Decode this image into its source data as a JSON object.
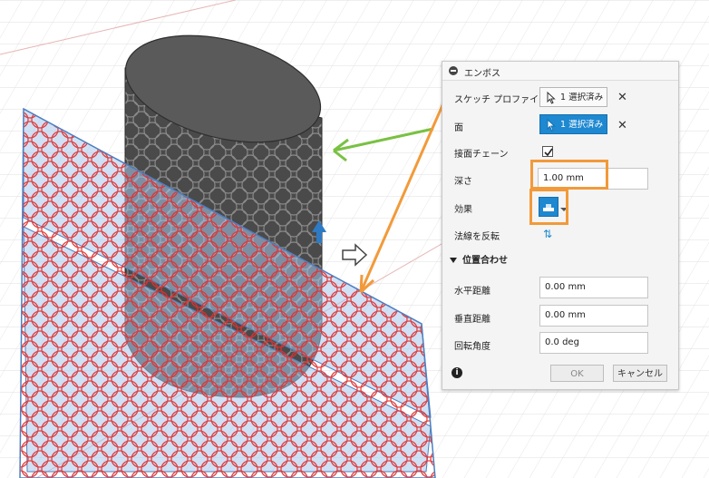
{
  "dialog": {
    "title": "エンボス",
    "rows": {
      "sketch_profile": {
        "label": "スケッチ プロファイル",
        "selection": "1 選択済み"
      },
      "face": {
        "label": "面",
        "selection": "1 選択済み"
      },
      "tangent_chain": {
        "label": "接面チェーン",
        "checked": true
      },
      "depth": {
        "label": "深さ",
        "value": "1.00 mm"
      },
      "effect": {
        "label": "効果"
      },
      "flip_direction": {
        "label": "法線を反転"
      }
    },
    "alignment": {
      "section_label": "位置合わせ",
      "horizontal": {
        "label": "水平距離",
        "value": "0.00 mm"
      },
      "vertical": {
        "label": "垂直距離",
        "value": "0.00 mm"
      },
      "rotation": {
        "label": "回転角度",
        "value": "0.0 deg"
      }
    },
    "footer": {
      "ok_label": "OK",
      "cancel_label": "キャンセル"
    }
  },
  "colors": {
    "accent_blue": "#1e88d0",
    "annotation_orange": "#f29a3a",
    "annotation_green": "#7ac143",
    "profile_red": "#e03030",
    "sketch_plane": "#a9c8ec",
    "body_dark": "#4a4a4a"
  },
  "icons": [
    "collapse-icon",
    "cursor-select-icon",
    "close-icon",
    "checkmark-icon",
    "emboss-effect-icon",
    "flip-arrows-icon",
    "info-icon",
    "move-arrow-icon"
  ]
}
